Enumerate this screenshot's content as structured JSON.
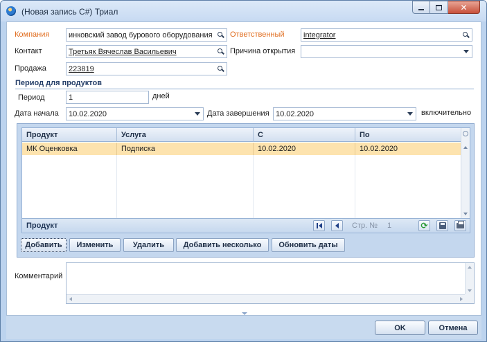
{
  "window": {
    "title": "(Новая запись C#) Триал",
    "controls": [
      "minimize-icon",
      "maximize-icon",
      "close-icon"
    ],
    "close_glyph": "✕"
  },
  "form": {
    "company": {
      "label": "Компания",
      "value": "инковский завод бурового оборудования"
    },
    "responsible": {
      "label": "Ответственный",
      "value": "integrator"
    },
    "contact": {
      "label": "Контакт",
      "value": "Третьяк Вячеслав Васильевич"
    },
    "reason": {
      "label": "Причина открытия",
      "value": ""
    },
    "sale": {
      "label": "Продажа",
      "value": "223819"
    }
  },
  "period_section": {
    "title": "Период для продуктов",
    "period_label": "Период",
    "period_value": "1",
    "period_unit": "дней",
    "start_label": "Дата начала",
    "start_value": "10.02.2020",
    "end_label": "Дата завершения",
    "end_value": "10.02.2020",
    "inclusive_label": "включительно"
  },
  "grid": {
    "columns": [
      "Продукт",
      "Услуга",
      "С",
      "По"
    ],
    "rows": [
      {
        "product": "МК Оценковка",
        "service": "Подписка",
        "from": "10.02.2020",
        "to": "10.02.2020"
      }
    ],
    "footer_title": "Продукт",
    "page_label": "Стр. №",
    "page_number": "1"
  },
  "actions": {
    "add": "Добавить",
    "edit": "Изменить",
    "delete": "Удалить",
    "add_multiple": "Добавить несколько",
    "update_dates": "Обновить даты"
  },
  "comment": {
    "label": "Комментарий",
    "value": ""
  },
  "dialog_buttons": {
    "ok": "OK",
    "cancel": "Отмена"
  },
  "colors": {
    "required_label": "#e06b1c",
    "selected_row": "#fde3ae",
    "frame": "#c8daef"
  }
}
